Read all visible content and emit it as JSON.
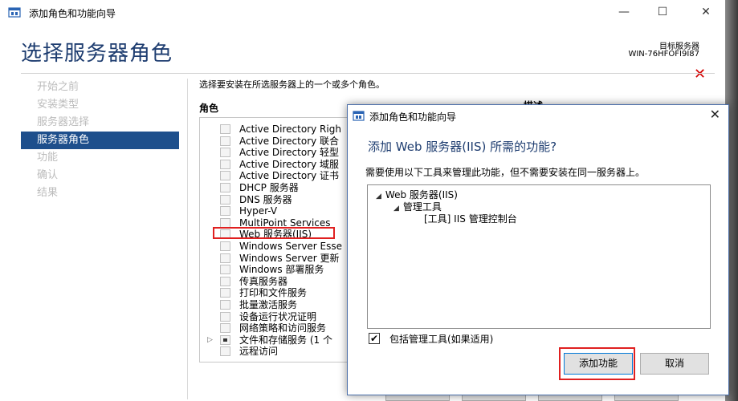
{
  "window": {
    "title": "添加角色和功能向导",
    "heading": "选择服务器角色",
    "destination_label": "目标服务器",
    "destination_server": "WIN-76HFOFI9I87",
    "min_glyph": "—",
    "max_glyph": "☐",
    "close_glyph": "✕"
  },
  "nav": {
    "items": [
      {
        "label": "开始之前"
      },
      {
        "label": "安装类型"
      },
      {
        "label": "服务器选择"
      },
      {
        "label": "服务器角色",
        "active": true
      },
      {
        "label": "功能"
      },
      {
        "label": "确认"
      },
      {
        "label": "结果"
      }
    ]
  },
  "main": {
    "intro": "选择要安装在所选服务器上的一个或多个角色。",
    "roles_header": "角色",
    "description_header": "描述",
    "roles": [
      {
        "label": "Active Directory Righ"
      },
      {
        "label": "Active Directory 联合"
      },
      {
        "label": "Active Directory 轻型"
      },
      {
        "label": "Active Directory 域服"
      },
      {
        "label": "Active Directory 证书"
      },
      {
        "label": "DHCP 服务器"
      },
      {
        "label": "DNS 服务器"
      },
      {
        "label": "Hyper-V"
      },
      {
        "label": "MultiPoint Services"
      },
      {
        "label": "Web 服务器(IIS)"
      },
      {
        "label": "Windows Server Esse"
      },
      {
        "label": "Windows Server 更新"
      },
      {
        "label": "Windows 部署服务"
      },
      {
        "label": "传真服务器"
      },
      {
        "label": "打印和文件服务"
      },
      {
        "label": "批量激活服务"
      },
      {
        "label": "设备运行状况证明"
      },
      {
        "label": "网络策略和访问服务"
      },
      {
        "label": "文件和存储服务 (1 个",
        "partial": true,
        "expandable": true
      },
      {
        "label": "远程访问"
      }
    ],
    "red_x": "✕"
  },
  "dialog": {
    "title": "添加角色和功能向导",
    "heading": "添加 Web 服务器(IIS) 所需的功能?",
    "text": "需要使用以下工具来管理此功能，但不需要安装在同一服务器上。",
    "tree": [
      {
        "label": "Web 服务器(IIS)",
        "level": 0,
        "expandable": true
      },
      {
        "label": "管理工具",
        "level": 1,
        "expandable": true
      },
      {
        "label": "[工具] IIS 管理控制台",
        "level": 2,
        "expandable": false
      }
    ],
    "include_tools_label": "包括管理工具(如果适用)",
    "include_tools_checked": true,
    "checkmark": "✔",
    "add_button": "添加功能",
    "cancel_button": "取消",
    "close_glyph": "✕"
  }
}
